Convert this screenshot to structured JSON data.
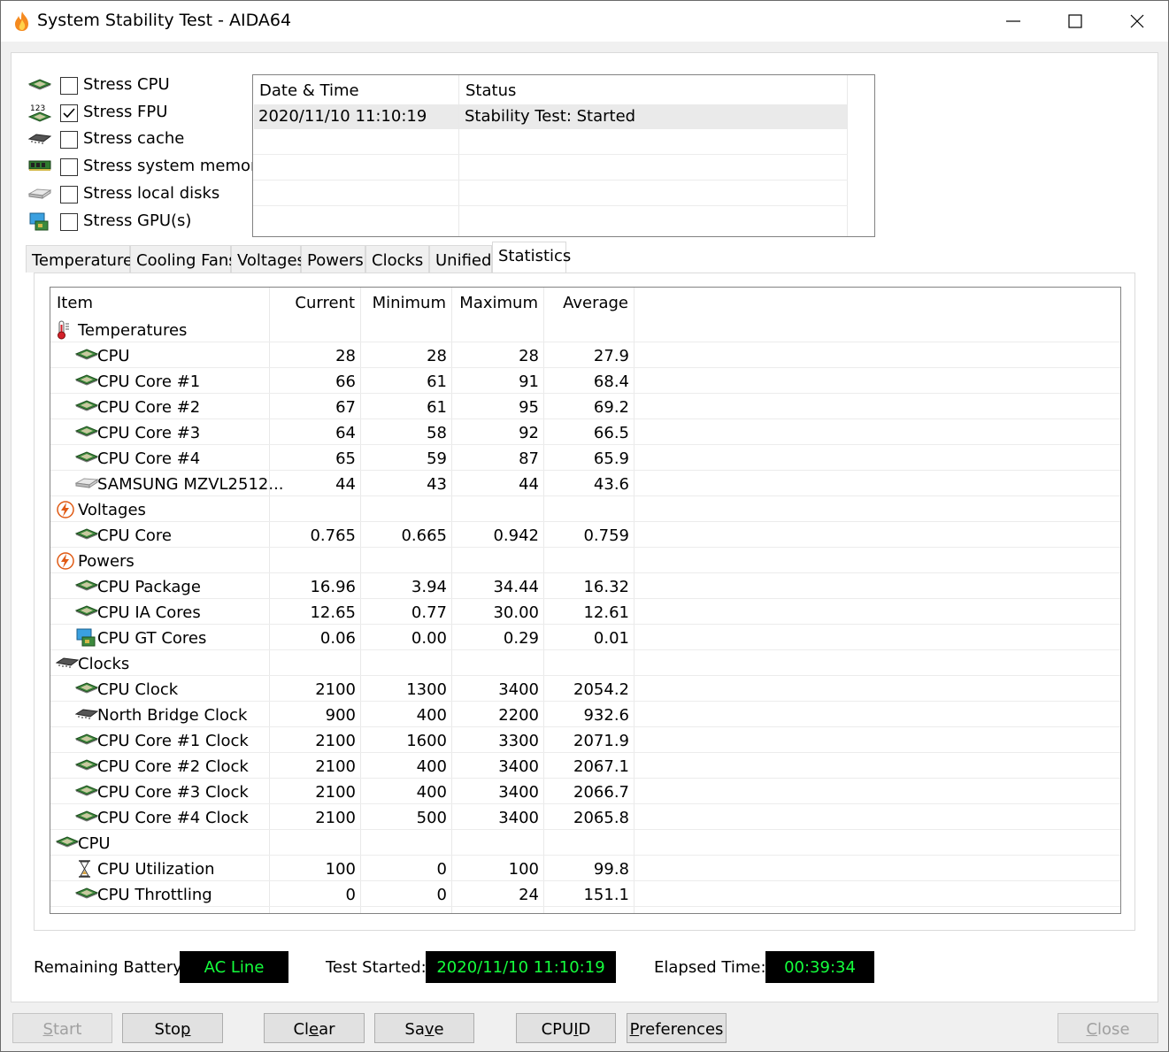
{
  "window": {
    "title": "System Stability Test - AIDA64"
  },
  "options": [
    {
      "label": "Stress CPU",
      "checked": false,
      "icon": "cpu-chip-icon"
    },
    {
      "label": "Stress FPU",
      "checked": true,
      "icon": "fpu-123-icon"
    },
    {
      "label": "Stress cache",
      "checked": false,
      "icon": "cache-chip-icon"
    },
    {
      "label": "Stress system memory",
      "checked": false,
      "icon": "memory-module-icon"
    },
    {
      "label": "Stress local disks",
      "checked": false,
      "icon": "disk-drive-icon"
    },
    {
      "label": "Stress GPU(s)",
      "checked": false,
      "icon": "gpu-monitor-icon"
    }
  ],
  "log": {
    "headers": {
      "datetime": "Date & Time",
      "status": "Status"
    },
    "rows": [
      {
        "datetime": "2020/11/10 11:10:19",
        "status": "Stability Test: Started"
      }
    ]
  },
  "tabs": [
    "Temperatures",
    "Cooling Fans",
    "Voltages",
    "Powers",
    "Clocks",
    "Unified",
    "Statistics"
  ],
  "active_tab": "Statistics",
  "stats": {
    "headers": {
      "item": "Item",
      "current": "Current",
      "minimum": "Minimum",
      "maximum": "Maximum",
      "average": "Average"
    },
    "rows": [
      {
        "group": true,
        "label": "Temperatures",
        "icon": "thermometer-icon"
      },
      {
        "label": "CPU",
        "icon": "cpu-chip-icon",
        "current": "28",
        "minimum": "28",
        "maximum": "28",
        "average": "27.9"
      },
      {
        "label": "CPU Core #1",
        "icon": "cpu-chip-icon",
        "current": "66",
        "minimum": "61",
        "maximum": "91",
        "average": "68.4"
      },
      {
        "label": "CPU Core #2",
        "icon": "cpu-chip-icon",
        "current": "67",
        "minimum": "61",
        "maximum": "95",
        "average": "69.2"
      },
      {
        "label": "CPU Core #3",
        "icon": "cpu-chip-icon",
        "current": "64",
        "minimum": "58",
        "maximum": "92",
        "average": "66.5"
      },
      {
        "label": "CPU Core #4",
        "icon": "cpu-chip-icon",
        "current": "65",
        "minimum": "59",
        "maximum": "87",
        "average": "65.9"
      },
      {
        "label": "SAMSUNG MZVL2512...",
        "icon": "disk-drive-icon",
        "current": "44",
        "minimum": "43",
        "maximum": "44",
        "average": "43.6"
      },
      {
        "group": true,
        "label": "Voltages",
        "icon": "lightning-icon"
      },
      {
        "label": "CPU Core",
        "icon": "cpu-chip-icon",
        "current": "0.765",
        "minimum": "0.665",
        "maximum": "0.942",
        "average": "0.759"
      },
      {
        "group": true,
        "label": "Powers",
        "icon": "lightning-icon"
      },
      {
        "label": "CPU Package",
        "icon": "cpu-chip-icon",
        "current": "16.96",
        "minimum": "3.94",
        "maximum": "34.44",
        "average": "16.32"
      },
      {
        "label": "CPU IA Cores",
        "icon": "cpu-chip-icon",
        "current": "12.65",
        "minimum": "0.77",
        "maximum": "30.00",
        "average": "12.61"
      },
      {
        "label": "CPU GT Cores",
        "icon": "gpu-monitor-icon",
        "current": "0.06",
        "minimum": "0.00",
        "maximum": "0.29",
        "average": "0.01"
      },
      {
        "group": true,
        "label": "Clocks",
        "icon": "clock-chip-icon"
      },
      {
        "label": "CPU Clock",
        "icon": "cpu-chip-icon",
        "current": "2100",
        "minimum": "1300",
        "maximum": "3400",
        "average": "2054.2"
      },
      {
        "label": "North Bridge Clock",
        "icon": "cache-chip-icon",
        "current": "900",
        "minimum": "400",
        "maximum": "2200",
        "average": "932.6"
      },
      {
        "label": "CPU Core #1 Clock",
        "icon": "cpu-chip-icon",
        "current": "2100",
        "minimum": "1600",
        "maximum": "3300",
        "average": "2071.9"
      },
      {
        "label": "CPU Core #2 Clock",
        "icon": "cpu-chip-icon",
        "current": "2100",
        "minimum": "400",
        "maximum": "3400",
        "average": "2067.1"
      },
      {
        "label": "CPU Core #3 Clock",
        "icon": "cpu-chip-icon",
        "current": "2100",
        "minimum": "400",
        "maximum": "3400",
        "average": "2066.7"
      },
      {
        "label": "CPU Core #4 Clock",
        "icon": "cpu-chip-icon",
        "current": "2100",
        "minimum": "500",
        "maximum": "3400",
        "average": "2065.8"
      },
      {
        "group": true,
        "label": "CPU",
        "icon": "cpu-chip-icon"
      },
      {
        "label": "CPU Utilization",
        "icon": "hourglass-icon",
        "current": "100",
        "minimum": "0",
        "maximum": "100",
        "average": "99.8"
      },
      {
        "label": "CPU Throttling",
        "icon": "cpu-chip-icon",
        "current": "0",
        "minimum": "0",
        "maximum": "24",
        "average": "151.1"
      }
    ]
  },
  "status": {
    "battery_label": "Remaining Battery:",
    "battery_value": "AC Line",
    "started_label": "Test Started:",
    "started_value": "2020/11/10 11:10:19",
    "elapsed_label": "Elapsed Time:",
    "elapsed_value": "00:39:34",
    "value_color": "#14ff3c"
  },
  "buttons": {
    "start": {
      "label": "Start",
      "mnemonic": "S",
      "rest": "tart",
      "enabled": false
    },
    "stop": {
      "label": "Stop",
      "mnemonic": "p",
      "pre": "Sto",
      "enabled": true
    },
    "clear": {
      "label": "Clear",
      "pre": "Cl",
      "mnemonic": "e",
      "rest": "ar",
      "enabled": true
    },
    "save": {
      "label": "Save",
      "pre": "Sa",
      "mnemonic": "v",
      "rest": "e",
      "enabled": true
    },
    "cpuid": {
      "label": "CPUID",
      "pre": "CPU",
      "mnemonic": "I",
      "rest": "D",
      "enabled": true
    },
    "preferences": {
      "label": "Preferences",
      "mnemonic": "P",
      "rest": "references",
      "enabled": true
    },
    "close": {
      "label": "Close",
      "mnemonic": "C",
      "rest": "lose",
      "enabled": false
    }
  }
}
